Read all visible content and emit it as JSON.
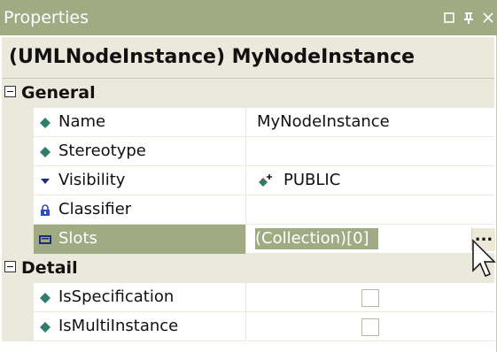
{
  "window": {
    "title": "Properties",
    "buttons": [
      "restore",
      "pin",
      "close"
    ]
  },
  "header": {
    "title": "(UMLNodeInstance) MyNodeInstance"
  },
  "categories": [
    {
      "label": "General",
      "expanded": true,
      "properties": [
        {
          "name": "Name",
          "value": "MyNodeInstance",
          "icon": "diamond-icon"
        },
        {
          "name": "Stereotype",
          "value": "",
          "icon": "diamond-icon"
        },
        {
          "name": "Visibility",
          "value": "PUBLIC",
          "icon": "down-triangle-icon",
          "value_icon": "public-visibility-icon"
        },
        {
          "name": "Classifier",
          "value": "",
          "icon": "lock-icon"
        },
        {
          "name": "Slots",
          "value": "(Collection)[0]",
          "icon": "collection-icon",
          "selected": true,
          "button_label": "..."
        }
      ]
    },
    {
      "label": "Detail",
      "expanded": true,
      "properties": [
        {
          "name": "IsSpecification",
          "value": "",
          "icon": "diamond-icon",
          "checked": false
        },
        {
          "name": "IsMultiInstance",
          "value": "",
          "icon": "diamond-icon",
          "checked": false
        }
      ]
    }
  ],
  "colors": {
    "titlebar": "#a0ab84",
    "selection": "#a0ab84",
    "category_bg": "#ebe9dc",
    "diamond": "#2e7d6d"
  }
}
